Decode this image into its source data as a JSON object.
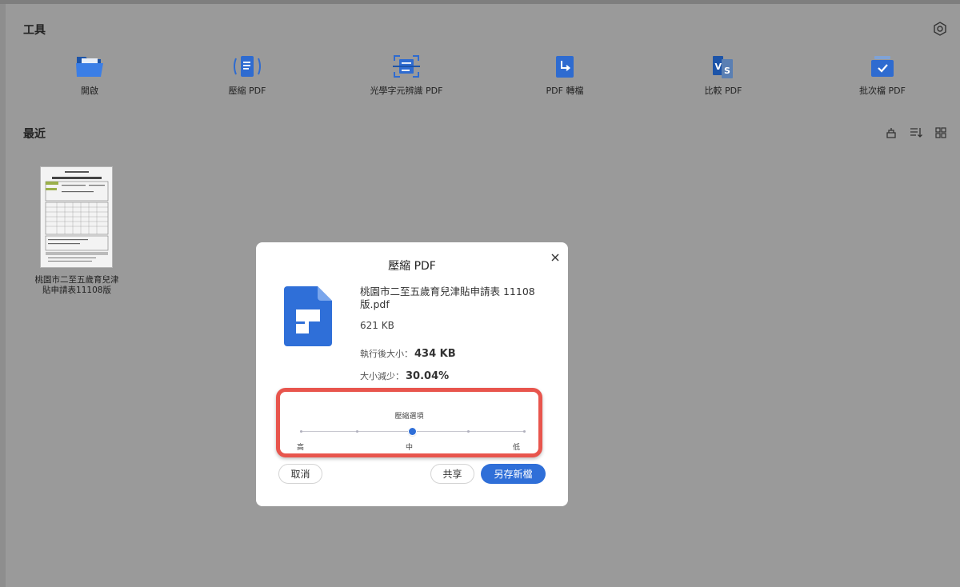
{
  "tools": {
    "title": "工具",
    "items": [
      {
        "label": "開啟",
        "icon": "folder-icon"
      },
      {
        "label": "壓縮 PDF",
        "icon": "compress-pdf-icon"
      },
      {
        "label": "光學字元辨識 PDF",
        "icon": "ocr-scan-icon"
      },
      {
        "label": "PDF 轉檔",
        "icon": "convert-pdf-icon"
      },
      {
        "label": "比較 PDF",
        "icon": "compare-pdf-icon"
      },
      {
        "label": "批次檔 PDF",
        "icon": "batch-pdf-icon"
      }
    ]
  },
  "recent": {
    "title": "最近",
    "files": [
      {
        "name": "桃園市二至五歲育兒津貼申請表11108版"
      }
    ]
  },
  "dialog": {
    "title": "壓縮 PDF",
    "file_name": "桃園市二至五歲育兒津貼申請表 11108 版.pdf",
    "file_size": "621 KB",
    "after_label": "執行後大小：",
    "after_value": "434 KB",
    "reduce_label": "大小減少：",
    "reduce_value": "30.04%",
    "options_title": "壓縮選項",
    "options": [
      "高",
      "中",
      "低"
    ],
    "selected_option": "中",
    "cancel_label": "取消",
    "share_label": "共享",
    "save_label": "另存新檔"
  },
  "colors": {
    "accent": "#2f6fd8",
    "highlight": "#e8554d",
    "overlay": "#9a9a9a"
  }
}
